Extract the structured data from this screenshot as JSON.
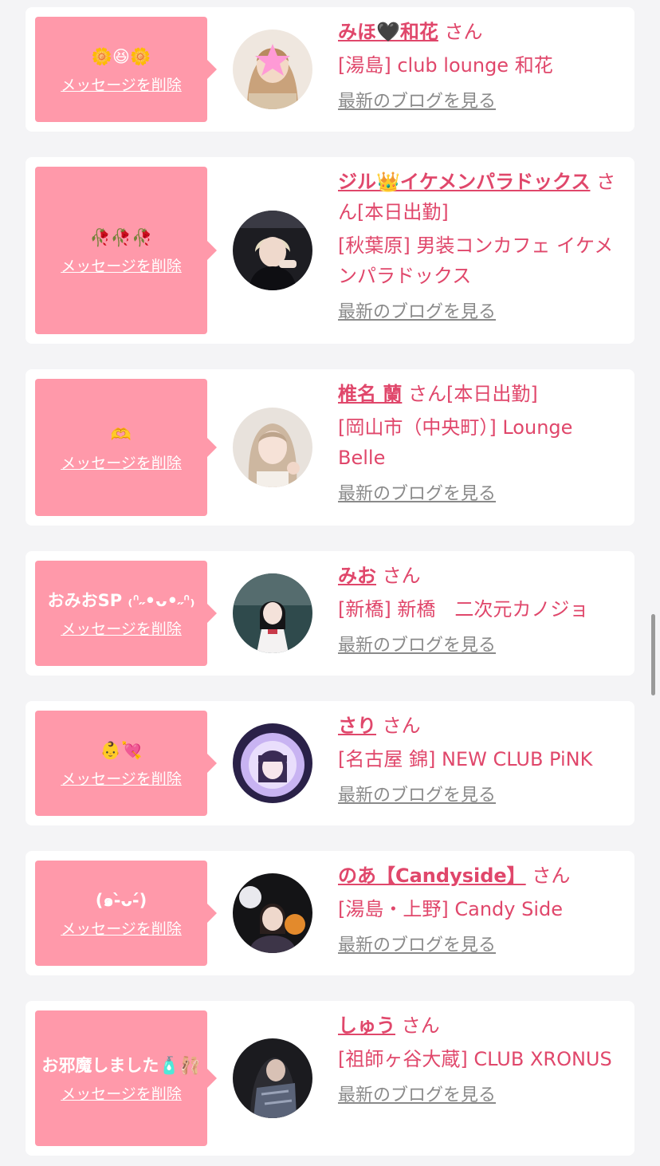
{
  "delete_label": "メッセージを削除",
  "honorific": "さん",
  "blog_label": "最新のブログを見る",
  "cards": [
    {
      "message": "🌼😆🌼",
      "name": "みほ🖤和花",
      "status": "",
      "shop": "[湯島] club lounge 和花"
    },
    {
      "message": "🥀🥀🥀",
      "name": "ジル👑イケメンパラドックス",
      "status": "[本日出勤]",
      "shop": "[秋葉原] 男装コンカフェ イケメンパラドックス"
    },
    {
      "message": "🫶",
      "name": "椎名 蘭",
      "status": "[本日出勤]",
      "shop": "[岡山市（中央町）] Lounge Belle"
    },
    {
      "message": "おみおSP ₍ᐢ˶•ᴗ•˶ᐢ₎",
      "name": "みお",
      "status": "",
      "shop": "[新橋] 新橋　二次元カノジョ"
    },
    {
      "message": "👶💘",
      "name": "さり",
      "status": "",
      "shop": "[名古屋 錦] NEW CLUB PiNK"
    },
    {
      "message": "(๑-̀ᴗ-́)",
      "name": "のあ【Candyside】",
      "status": "",
      "shop": "[湯島・上野] Candy Side"
    },
    {
      "message": "お邪魔しました🧴🩰",
      "name": "しゅう",
      "status": "",
      "shop": "[祖師ヶ谷大蔵] CLUB XRONUS"
    }
  ],
  "colors": {
    "accent": "#e0476b",
    "bubble": "#ff99aa",
    "background": "#f4f4f6"
  }
}
